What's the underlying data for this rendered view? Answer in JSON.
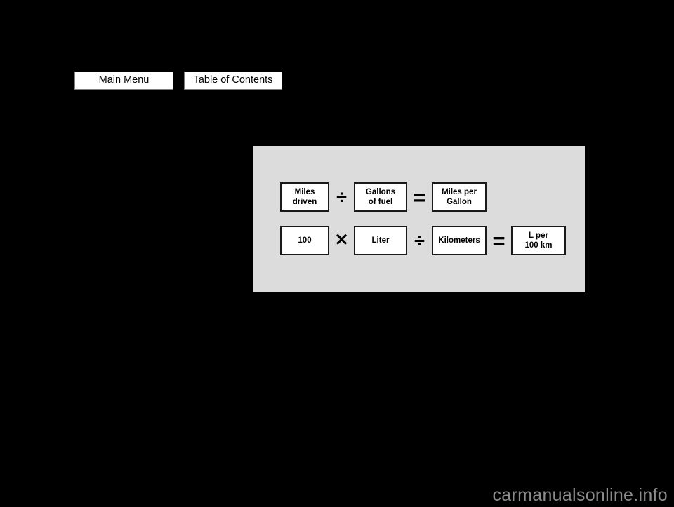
{
  "page": {
    "background_color": "#000000",
    "watermark": "carmanualsonline.info"
  },
  "navigation": {
    "buttons": [
      {
        "label": "Main Menu"
      },
      {
        "label": "Table of Contents"
      }
    ]
  },
  "figure": {
    "background_color": "#dcdcdc",
    "rows": [
      {
        "id": "mpg-formula",
        "elements": [
          {
            "type": "box",
            "text": "Miles\ndriven"
          },
          {
            "type": "operator",
            "symbol": "÷",
            "name": "divide"
          },
          {
            "type": "box",
            "text": "Gallons\nof fuel"
          },
          {
            "type": "operator",
            "symbol": "=",
            "name": "equals"
          },
          {
            "type": "box",
            "text": "Miles per\nGallon"
          }
        ]
      },
      {
        "id": "l-per-100km-formula",
        "elements": [
          {
            "type": "box",
            "text": "100"
          },
          {
            "type": "operator",
            "symbol": "✕",
            "name": "multiply"
          },
          {
            "type": "box",
            "text": "Liter"
          },
          {
            "type": "operator",
            "symbol": "÷",
            "name": "divide"
          },
          {
            "type": "box",
            "text": "Kilometers"
          },
          {
            "type": "operator",
            "symbol": "=",
            "name": "equals"
          },
          {
            "type": "box",
            "text": "L per\n100 km"
          }
        ]
      }
    ],
    "row1": {
      "box1_line1": "Miles",
      "box1_line2": "driven",
      "op1": "÷",
      "box2_line1": "Gallons",
      "box2_line2": "of fuel",
      "op2": "=",
      "box3_line1": "Miles per",
      "box3_line2": "Gallon"
    },
    "row2": {
      "box1": "100",
      "op1": "✕",
      "box2": "Liter",
      "op2": "÷",
      "box3": "Kilometers",
      "op3": "=",
      "box4_line1": "L per",
      "box4_line2": "100 km"
    }
  }
}
